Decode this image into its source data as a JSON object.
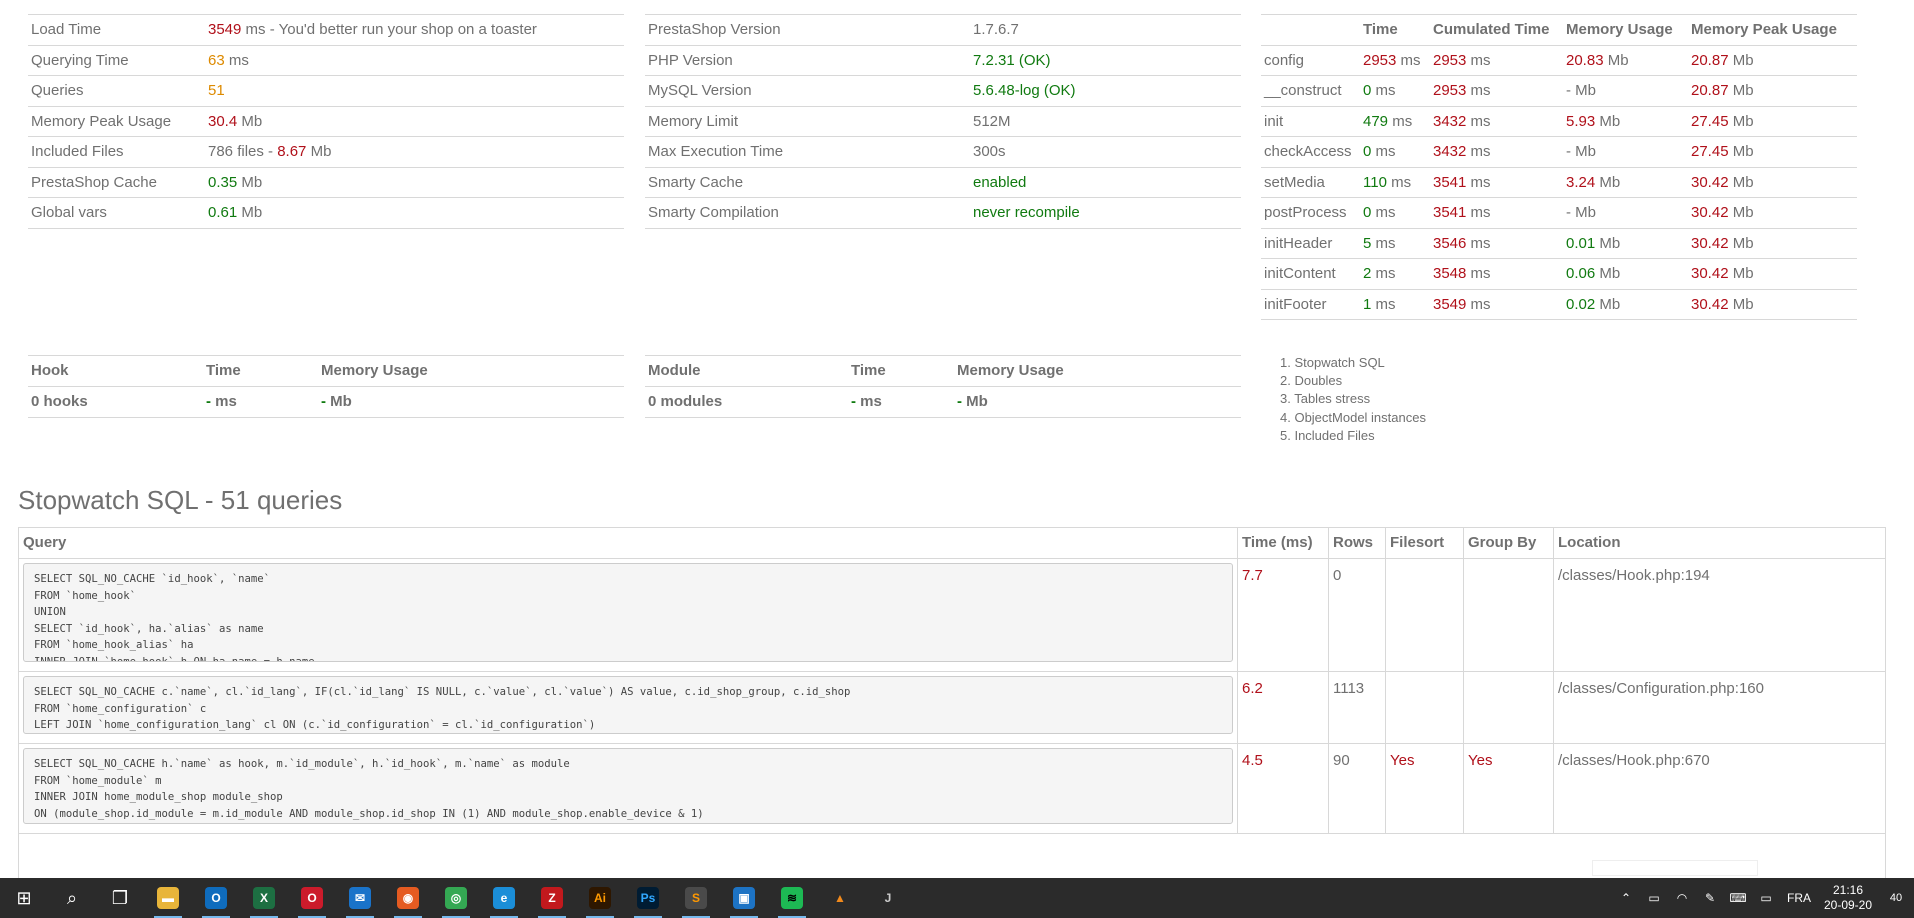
{
  "info": [
    {
      "key": "Load Time",
      "parts": [
        {
          "t": "3549",
          "c": "red"
        },
        {
          "t": " ms - You'd better run your shop on a toaster",
          "c": "gray"
        }
      ]
    },
    {
      "key": "Querying Time",
      "parts": [
        {
          "t": "63",
          "c": "orange"
        },
        {
          "t": " ms",
          "c": "gray"
        }
      ]
    },
    {
      "key": "Queries",
      "parts": [
        {
          "t": "51",
          "c": "orange"
        }
      ]
    },
    {
      "key": "Memory Peak Usage",
      "parts": [
        {
          "t": "30.4",
          "c": "red"
        },
        {
          "t": " Mb",
          "c": "gray"
        }
      ]
    },
    {
      "key": "Included Files",
      "parts": [
        {
          "t": "786 files - ",
          "c": "gray"
        },
        {
          "t": "8.67",
          "c": "red"
        },
        {
          "t": " Mb",
          "c": "gray"
        }
      ]
    },
    {
      "key": "PrestaShop Cache",
      "parts": [
        {
          "t": "0.35",
          "c": "green"
        },
        {
          "t": " Mb",
          "c": "gray"
        }
      ]
    },
    {
      "key": "Global vars",
      "parts": [
        {
          "t": "0.61",
          "c": "green"
        },
        {
          "t": " Mb",
          "c": "gray"
        }
      ]
    }
  ],
  "config": [
    {
      "key": "PrestaShop Version",
      "value": "1.7.6.7",
      "c": "gray"
    },
    {
      "key": "PHP Version",
      "value": "7.2.31 (OK)",
      "c": "green"
    },
    {
      "key": "MySQL Version",
      "value": "5.6.48-log (OK)",
      "c": "green"
    },
    {
      "key": "Memory Limit",
      "value": "512M",
      "c": "gray"
    },
    {
      "key": "Max Execution Time",
      "value": "300s",
      "c": "gray"
    },
    {
      "key": "Smarty Cache",
      "value": "enabled",
      "c": "green"
    },
    {
      "key": "Smarty Compilation",
      "value": "never recompile",
      "c": "green"
    }
  ],
  "timing": {
    "headers": [
      "",
      "Time",
      "Cumulated Time",
      "Memory Usage",
      "Memory Peak Usage"
    ],
    "rows": [
      {
        "name": "config",
        "time": "2953",
        "time_c": "red",
        "cum": "2953",
        "cum_c": "red",
        "mem": "20.83",
        "mem_c": "red",
        "peak": "20.87",
        "peak_c": "red"
      },
      {
        "name": "__construct",
        "time": "0",
        "time_c": "green",
        "cum": "2953",
        "cum_c": "red",
        "mem": "-",
        "mem_c": "gray",
        "peak": "20.87",
        "peak_c": "red"
      },
      {
        "name": "init",
        "time": "479",
        "time_c": "green",
        "cum": "3432",
        "cum_c": "red",
        "mem": "5.93",
        "mem_c": "red",
        "peak": "27.45",
        "peak_c": "red"
      },
      {
        "name": "checkAccess",
        "time": "0",
        "time_c": "green",
        "cum": "3432",
        "cum_c": "red",
        "mem": "-",
        "mem_c": "gray",
        "peak": "27.45",
        "peak_c": "red"
      },
      {
        "name": "setMedia",
        "time": "110",
        "time_c": "green",
        "cum": "3541",
        "cum_c": "red",
        "mem": "3.24",
        "mem_c": "red",
        "peak": "30.42",
        "peak_c": "red"
      },
      {
        "name": "postProcess",
        "time": "0",
        "time_c": "green",
        "cum": "3541",
        "cum_c": "red",
        "mem": "-",
        "mem_c": "gray",
        "peak": "30.42",
        "peak_c": "red"
      },
      {
        "name": "initHeader",
        "time": "5",
        "time_c": "green",
        "cum": "3546",
        "cum_c": "red",
        "mem": "0.01",
        "mem_c": "green",
        "peak": "30.42",
        "peak_c": "red"
      },
      {
        "name": "initContent",
        "time": "2",
        "time_c": "green",
        "cum": "3548",
        "cum_c": "red",
        "mem": "0.06",
        "mem_c": "green",
        "peak": "30.42",
        "peak_c": "red"
      },
      {
        "name": "initFooter",
        "time": "1",
        "time_c": "green",
        "cum": "3549",
        "cum_c": "red",
        "mem": "0.02",
        "mem_c": "green",
        "peak": "30.42",
        "peak_c": "red"
      }
    ],
    "ms": " ms",
    "mb": " Mb"
  },
  "hooks": {
    "headers": [
      "Hook",
      "Time",
      "Memory Usage"
    ],
    "name": "0 hooks",
    "time_val": "-",
    "time_unit": " ms",
    "mem_val": "-",
    "mem_unit": " Mb"
  },
  "modules": {
    "headers": [
      "Module",
      "Time",
      "Memory Usage"
    ],
    "name": "0 modules",
    "time_val": "-",
    "time_unit": " ms",
    "mem_val": "-",
    "mem_unit": " Mb"
  },
  "toc": [
    "1. Stopwatch SQL",
    "2. Doubles",
    "3. Tables stress",
    "4. ObjectModel instances",
    "5. Included Files"
  ],
  "sql": {
    "title": "Stopwatch SQL - 51 queries",
    "headers": [
      "Query",
      "Time (ms)",
      "Rows",
      "Filesort",
      "Group By",
      "Location"
    ],
    "rows": [
      {
        "query": "SELECT SQL_NO_CACHE `id_hook`, `name`\nFROM `home_hook`\nUNION\nSELECT `id_hook`, ha.`alias` as name\nFROM `home_hook_alias` ha\nINNER JOIN `home_hook` h ON ha.name = h.name",
        "time": "7.7",
        "rows": "0",
        "filesort": "",
        "groupby": "",
        "location": "/classes/Hook.php:194"
      },
      {
        "query": "SELECT SQL_NO_CACHE c.`name`, cl.`id_lang`, IF(cl.`id_lang` IS NULL, c.`value`, cl.`value`) AS value, c.id_shop_group, c.id_shop\nFROM `home_configuration` c\nLEFT JOIN `home_configuration_lang` cl ON (c.`id_configuration` = cl.`id_configuration`)",
        "time": "6.2",
        "rows": "1113",
        "filesort": "",
        "groupby": "",
        "location": "/classes/Configuration.php:160"
      },
      {
        "query": "SELECT SQL_NO_CACHE h.`name` as hook, m.`id_module`, h.`id_hook`, m.`name` as module\nFROM `home_module` m\nINNER JOIN home_module_shop module_shop\nON (module_shop.id_module = m.id_module AND module_shop.id_shop IN (1) AND module_shop.enable_device & 1)\nINNER JOIN `home_module_shop` `ms` ON ms.`id_module` = m.`id_module`",
        "time": "4.5",
        "rows": "90",
        "filesort": "Yes",
        "groupby": "Yes",
        "location": "/classes/Hook.php:670"
      }
    ]
  },
  "taskbar": {
    "apps": [
      {
        "name": "start-icon",
        "glyph": "⊞",
        "bg": "transparent",
        "fg": "#ffffff"
      },
      {
        "name": "search-icon",
        "glyph": "⌕",
        "bg": "transparent",
        "fg": "#ffffff"
      },
      {
        "name": "task-view-icon",
        "glyph": "❐",
        "bg": "transparent",
        "fg": "#ffffff"
      },
      {
        "name": "file-explorer-icon",
        "glyph": "▬",
        "bg": "#e8b53a",
        "fg": "#ffffff"
      },
      {
        "name": "outlook-icon",
        "glyph": "O",
        "bg": "#0f6cbd",
        "fg": "#ffffff"
      },
      {
        "name": "excel-icon",
        "glyph": "X",
        "bg": "#1d6f42",
        "fg": "#ffffff"
      },
      {
        "name": "opera-icon",
        "glyph": "O",
        "bg": "#cc1b2b",
        "fg": "#ffffff"
      },
      {
        "name": "thunderbird-icon",
        "glyph": "✉",
        "bg": "#1a73c9",
        "fg": "#ffffff"
      },
      {
        "name": "firefox-icon",
        "glyph": "◉",
        "bg": "#e55b21",
        "fg": "#ffffff"
      },
      {
        "name": "chrome-icon",
        "glyph": "◎",
        "bg": "#34a853",
        "fg": "#ffffff"
      },
      {
        "name": "edge-icon",
        "glyph": "e",
        "bg": "#1b8ed8",
        "fg": "#ffffff"
      },
      {
        "name": "filezilla-icon",
        "glyph": "Z",
        "bg": "#c2191d",
        "fg": "#ffffff"
      },
      {
        "name": "illustrator-icon",
        "glyph": "Ai",
        "bg": "#2e1700",
        "fg": "#ff9a00"
      },
      {
        "name": "photoshop-icon",
        "glyph": "Ps",
        "bg": "#001c33",
        "fg": "#31a8ff"
      },
      {
        "name": "sublime-text-icon",
        "glyph": "S",
        "bg": "#4a4a4a",
        "fg": "#ff9800"
      },
      {
        "name": "notes-app-icon",
        "glyph": "▣",
        "bg": "#1d73c4",
        "fg": "#ffffff"
      },
      {
        "name": "spotify-icon",
        "glyph": "≋",
        "bg": "#1db954",
        "fg": "#000000"
      },
      {
        "name": "vlc-icon",
        "glyph": "▲",
        "bg": "transparent",
        "fg": "#f28a1c"
      },
      {
        "name": "java-app-icon",
        "glyph": "J",
        "bg": "transparent",
        "fg": "#cccccc"
      }
    ],
    "lang": "FRA",
    "time": "21:16",
    "date": "20-09-20",
    "notifications": "40"
  }
}
